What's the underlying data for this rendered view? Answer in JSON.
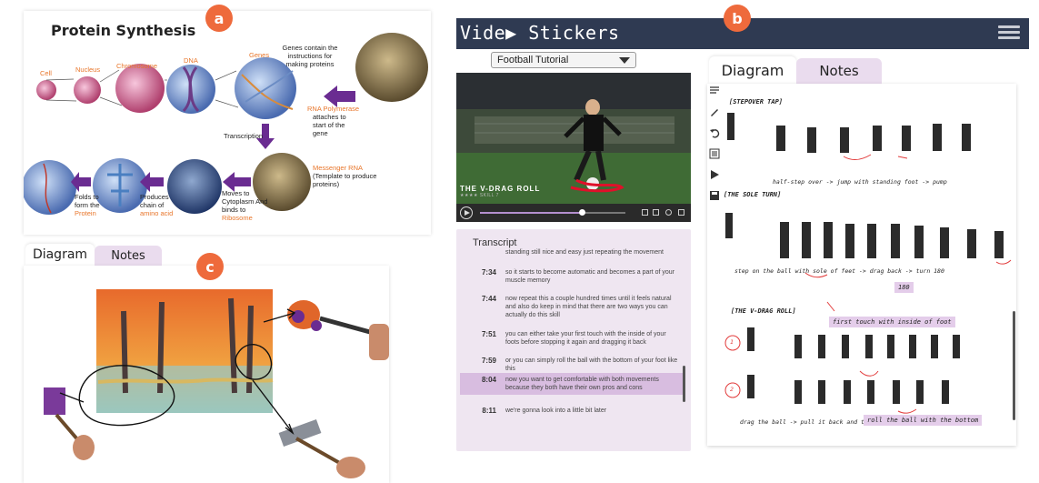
{
  "badges": {
    "a": "a",
    "b": "b",
    "c": "c"
  },
  "panel_a": {
    "title": "Protein Synthesis",
    "labels": {
      "cell": "Cell",
      "nucleus": "Nucleus",
      "chromosome": "Chromosome",
      "dna": "DNA",
      "genes": "Genes",
      "genes_note": "Genes contain the instructions for making proteins",
      "rna_polymerase": "RNA Polymerase",
      "rna_polymerase_note": "attaches to start of the gene",
      "transcription": "Transcription",
      "messenger_rna": "Messenger RNA",
      "messenger_rna_note": "(Template to produce proteins)",
      "moves_to": "Moves to Cytoplasm And binds to",
      "ribosome": "Ribosome",
      "produces": "Produces chain of",
      "amino_acid": "amino acid",
      "folds": "Folds to form the",
      "protein": "Protein"
    },
    "colors": {
      "orange": "#e8762b",
      "arrow": "#6a2c91"
    }
  },
  "panel_b": {
    "app_title": "Vide▶ Stickers",
    "menu_icon": "hamburger-menu-icon",
    "dropdown_value": "Football Tutorial",
    "video": {
      "caption": "THE V-DRAG ROLL",
      "caption_sub": "★★★★  SKILL 7",
      "progress_percent": 70
    },
    "transcript": {
      "title": "Transcript",
      "top_partial": "standing still nice and easy just repeating the movement",
      "rows": [
        {
          "time": "7:34",
          "text": "so it starts to become automatic and becomes a part of your muscle memory"
        },
        {
          "time": "7:44",
          "text": "now repeat this a couple hundred times until it feels natural and also do keep in mind that there are two ways you can actually do this skill"
        },
        {
          "time": "7:51",
          "text": "you can either take your first touch with the inside of your foots before stopping it again and dragging it back"
        },
        {
          "time": "7:59",
          "text": "or you can simply roll the ball with the bottom of your foot like this"
        },
        {
          "time": "8:04",
          "text": "now you want to get comfortable with both movements because they both have their own pros and cons"
        },
        {
          "time": "8:11",
          "text": "we're gonna look into a little bit later"
        }
      ],
      "active_index": 4
    },
    "tabs": {
      "diagram": "Diagram",
      "notes": "Notes"
    },
    "diagram": {
      "heading1": "[STEPOVER TAP]",
      "caption1": "half-step over -> jump with standing foot -> pump",
      "heading2": "[THE SOLE TURN]",
      "caption2": "step on the ball with sole of feet -> drag back -> turn 180",
      "note_180": "180",
      "heading3": "[THE V-DRAG ROLL]",
      "note_first_touch": "first touch with inside of foot",
      "num1": "1",
      "num2": "2",
      "caption3": "drag the ball -> pull it back and tap the ball",
      "note_roll": "roll the ball with the bottom"
    }
  },
  "panel_c": {
    "tabs": {
      "diagram": "Diagram",
      "notes": "Notes"
    }
  }
}
